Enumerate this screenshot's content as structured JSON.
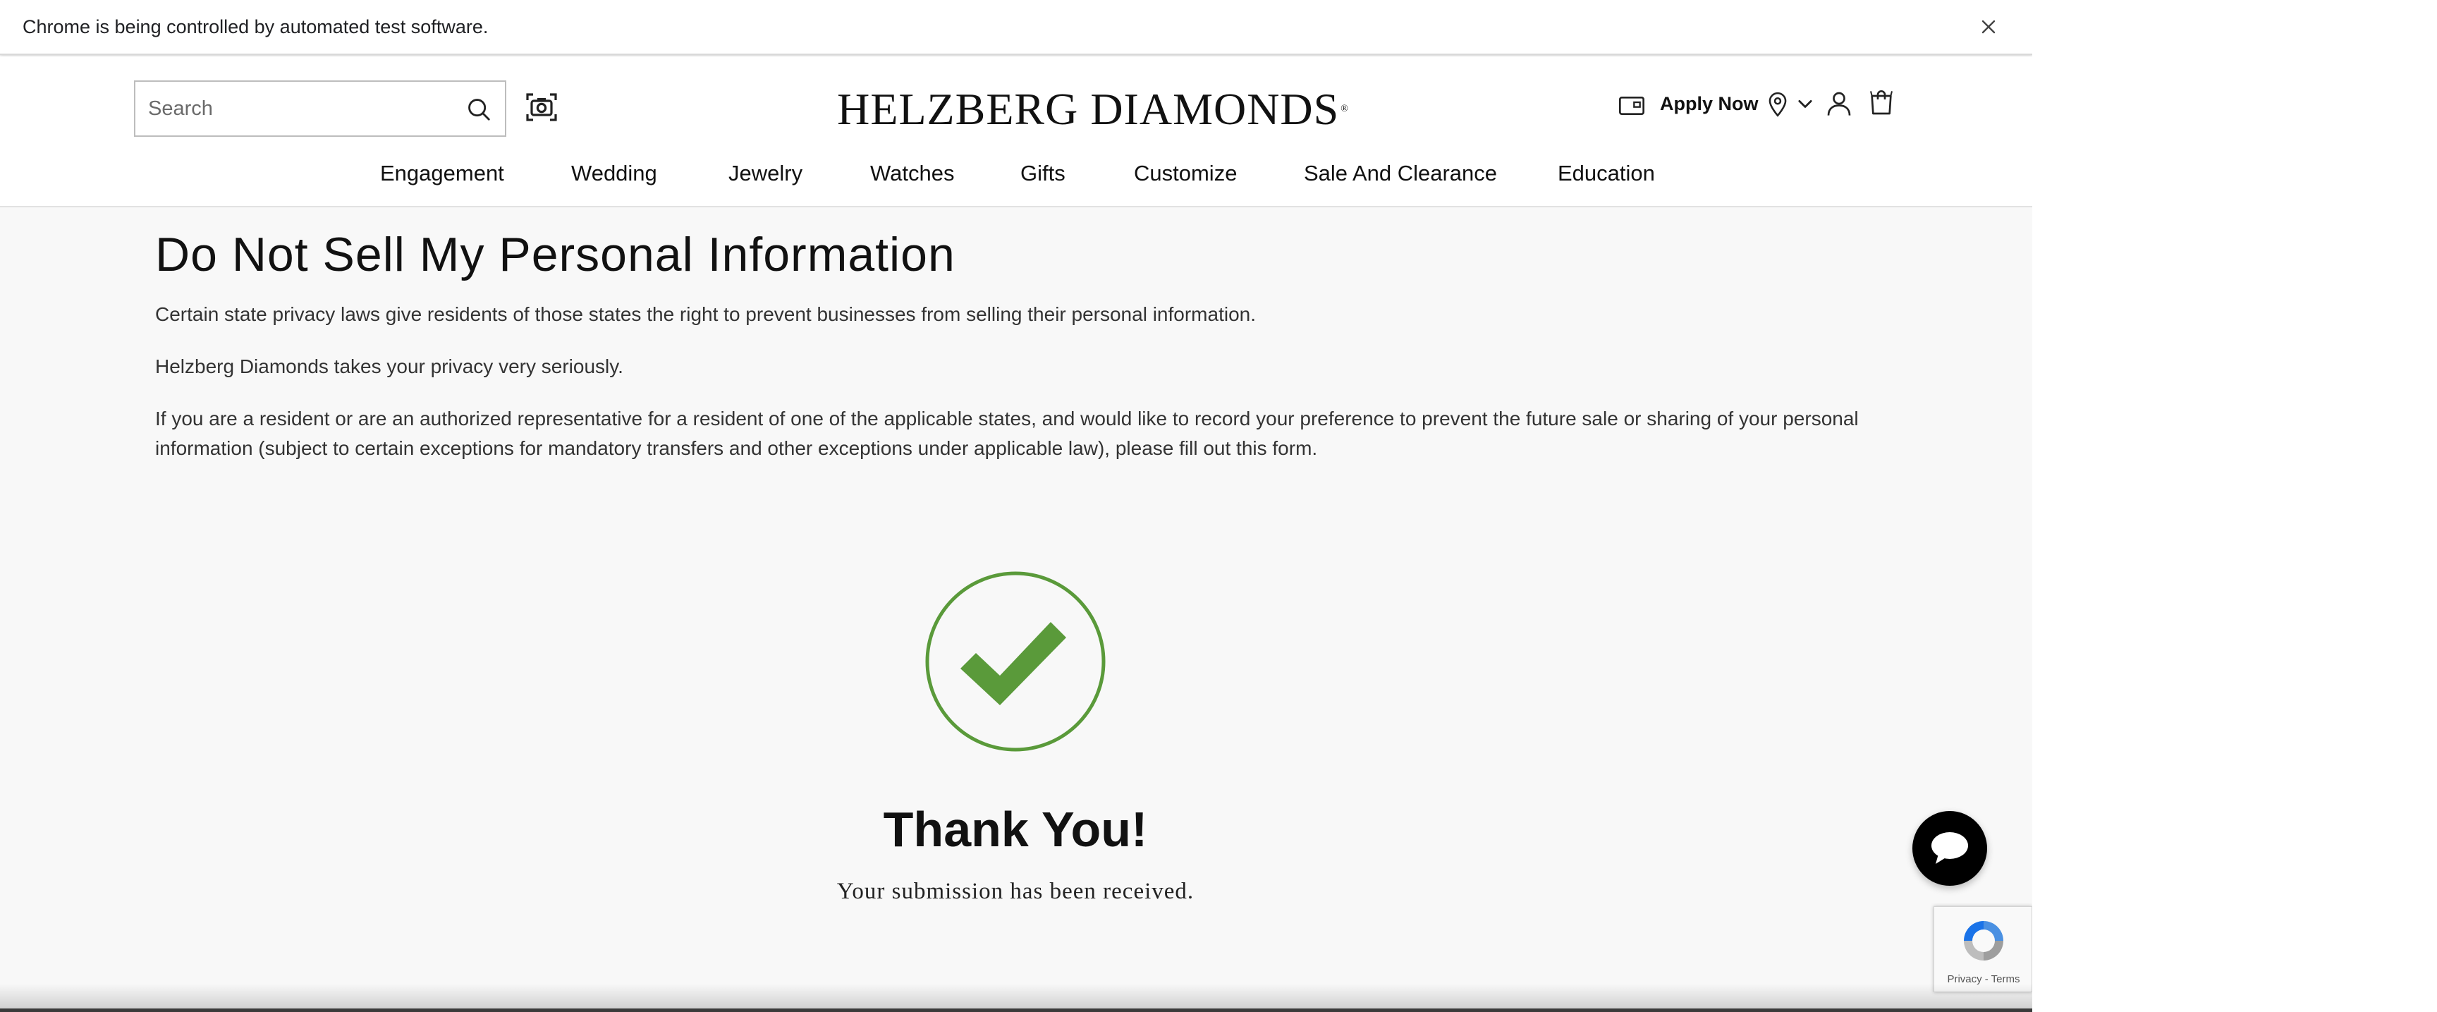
{
  "automation_bar": {
    "message": "Chrome is being controlled by automated test software."
  },
  "header": {
    "search_placeholder": "Search",
    "logo_text": "HELZBERG DIAMONDS",
    "logo_mark": "®",
    "apply_now": "Apply Now"
  },
  "nav": {
    "items": [
      {
        "label": "Engagement"
      },
      {
        "label": "Wedding"
      },
      {
        "label": "Jewelry"
      },
      {
        "label": "Watches"
      },
      {
        "label": "Gifts"
      },
      {
        "label": "Customize"
      },
      {
        "label": "Sale And Clearance"
      },
      {
        "label": "Education"
      }
    ]
  },
  "main": {
    "title": "Do Not Sell My Personal Information",
    "paragraphs": [
      "Certain state privacy laws give residents of those states the right to prevent businesses from selling their personal information.",
      "Helzberg Diamonds takes your privacy very seriously.",
      "If you are a resident or are an authorized representative for a resident of one of the applicable states, and would like to record your preference to prevent the future sale or sharing of your personal information (subject to certain exceptions for mandatory transfers and other exceptions under applicable law), please fill out this form."
    ],
    "thank_you": "Thank You!",
    "received": "Your submission has been received."
  },
  "recaptcha": {
    "links": "Privacy - Terms"
  },
  "colors": {
    "success_green": "#5a9a3a",
    "nav_text": "#111111",
    "page_bg": "#f8f8f8"
  },
  "icons": [
    "close-icon",
    "search-icon",
    "camera-icon",
    "card-icon",
    "location-pin-icon",
    "chevron-down-icon",
    "user-icon",
    "cart-icon",
    "checkmark-icon",
    "chat-icon",
    "recaptcha-icon"
  ]
}
